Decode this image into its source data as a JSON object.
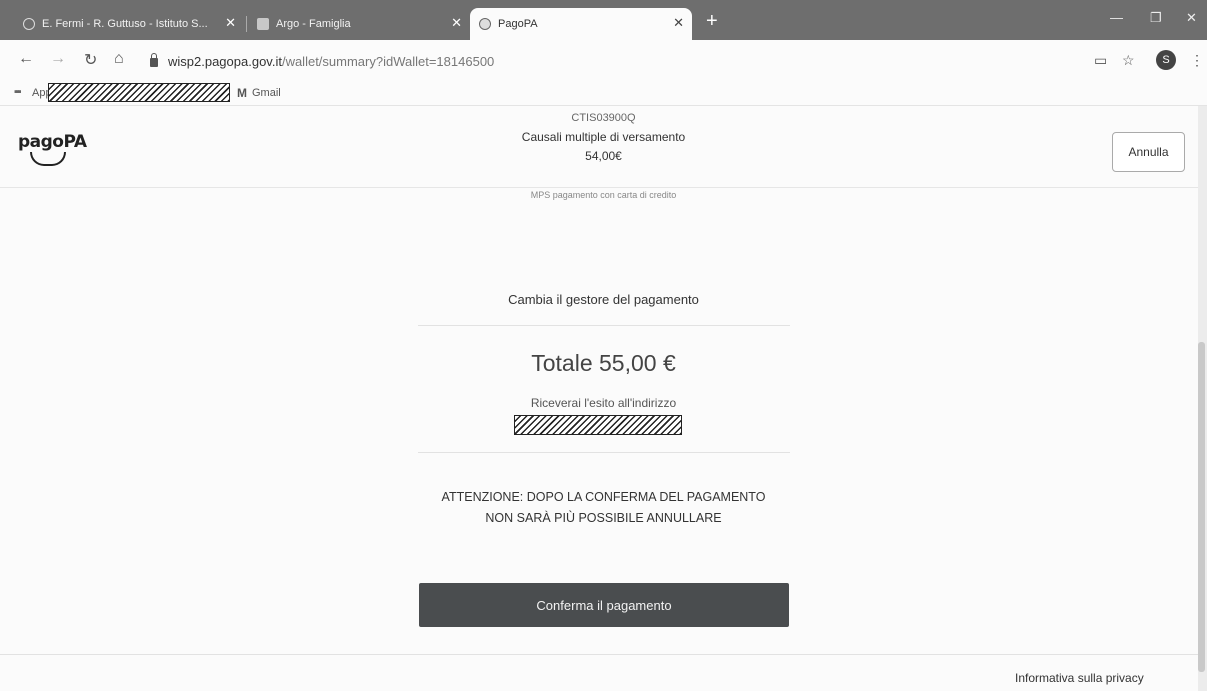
{
  "browser": {
    "tabs": [
      {
        "title": "E. Fermi - R. Guttuso - Istituto S..."
      },
      {
        "title": "Argo - Famiglia"
      },
      {
        "title": "PagoPA"
      }
    ],
    "url_host": "wisp2.pagopa.gov.it",
    "url_path": "/wallet/summary?idWallet=18146500",
    "profile_initial": "S",
    "bookmarks": {
      "apps": "App",
      "gmail": "Gmail"
    }
  },
  "header": {
    "logo": "pagoPA",
    "code": "CTIS03900Q",
    "description": "Causali multiple di versamento",
    "amount": "54,00€",
    "cancel_label": "Annulla"
  },
  "subheader": "MPS pagamento con carta di credito",
  "main": {
    "change_manager": "Cambia il gestore del pagamento",
    "total": "Totale 55,00 €",
    "receipt_label": "Riceverai l'esito all'indirizzo",
    "warning_line1": "ATTENZIONE: DOPO LA CONFERMA DEL PAGAMENTO",
    "warning_line2": "NON SARÀ PIÙ POSSIBILE ANNULLARE",
    "confirm_label": "Conferma il pagamento"
  },
  "footer": {
    "privacy": "Informativa sulla privacy"
  }
}
